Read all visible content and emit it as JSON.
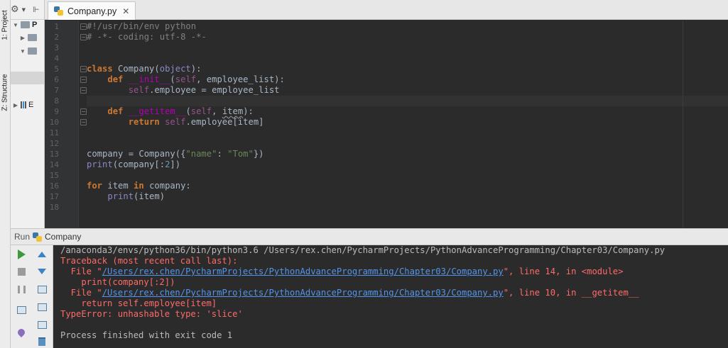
{
  "tool_windows": {
    "project_label": "1: Project",
    "structure_label": "Z: Structure"
  },
  "project_panel": {
    "rows": [
      {
        "label": "P",
        "arrow": "▼"
      },
      {
        "label": "",
        "arrow": "▶"
      },
      {
        "label": "",
        "arrow": "▼"
      },
      {
        "label": "",
        "arrow": ""
      },
      {
        "label": "E",
        "arrow": "▶"
      }
    ]
  },
  "editor_tab": {
    "filename": "Company.py",
    "close": "✕"
  },
  "editor": {
    "line_numbers": [
      "1",
      "2",
      "3",
      "4",
      "5",
      "6",
      "7",
      "8",
      "9",
      "10",
      "11",
      "12",
      "13",
      "14",
      "15",
      "16",
      "17",
      "18"
    ],
    "code": [
      [
        {
          "t": "#!/usr/bin/env python",
          "c": "cm"
        }
      ],
      [
        {
          "t": "# -*- coding: utf-8 -*-",
          "c": "cm"
        }
      ],
      [],
      [],
      [
        {
          "t": "class ",
          "c": "kw"
        },
        {
          "t": "Company",
          "c": "pl"
        },
        {
          "t": "(",
          "c": "pl"
        },
        {
          "t": "object",
          "c": "bi"
        },
        {
          "t": "):",
          "c": "pl"
        }
      ],
      [
        {
          "t": "    ",
          "c": "pl"
        },
        {
          "t": "def ",
          "c": "kw"
        },
        {
          "t": "__init__",
          "c": "mg"
        },
        {
          "t": "(",
          "c": "pl"
        },
        {
          "t": "self",
          "c": "sf"
        },
        {
          "t": ", employee_list):",
          "c": "pl"
        }
      ],
      [
        {
          "t": "        ",
          "c": "pl"
        },
        {
          "t": "self",
          "c": "sf"
        },
        {
          "t": ".employee = employee_list",
          "c": "pl"
        }
      ],
      [],
      [
        {
          "t": "    ",
          "c": "pl"
        },
        {
          "t": "def ",
          "c": "kw"
        },
        {
          "t": "__getitem__",
          "c": "mg"
        },
        {
          "t": "(",
          "c": "pl"
        },
        {
          "t": "self",
          "c": "sf"
        },
        {
          "t": ", ",
          "c": "pl"
        },
        {
          "t": "item",
          "c": "pl wavy"
        },
        {
          "t": "):",
          "c": "pl"
        }
      ],
      [
        {
          "t": "        ",
          "c": "pl"
        },
        {
          "t": "return ",
          "c": "kw"
        },
        {
          "t": "self",
          "c": "sf"
        },
        {
          "t": ".employee[item]",
          "c": "pl"
        }
      ],
      [],
      [],
      [
        {
          "t": "company = Company({",
          "c": "pl"
        },
        {
          "t": "\"name\"",
          "c": "st"
        },
        {
          "t": ": ",
          "c": "pl"
        },
        {
          "t": "\"Tom\"",
          "c": "st"
        },
        {
          "t": "})",
          "c": "pl"
        }
      ],
      [
        {
          "t": "print",
          "c": "bi"
        },
        {
          "t": "(company[:",
          "c": "pl"
        },
        {
          "t": "2",
          "c": "nm"
        },
        {
          "t": "])",
          "c": "pl"
        }
      ],
      [],
      [
        {
          "t": "for ",
          "c": "kw"
        },
        {
          "t": "item ",
          "c": "pl"
        },
        {
          "t": "in ",
          "c": "kw"
        },
        {
          "t": "company:",
          "c": "pl"
        }
      ],
      [
        {
          "t": "    ",
          "c": "pl"
        },
        {
          "t": "print",
          "c": "bi"
        },
        {
          "t": "(item)",
          "c": "pl"
        }
      ],
      []
    ],
    "current_line": 8
  },
  "run_panel": {
    "run_label": "Run",
    "config_name": "Company"
  },
  "console": {
    "command": "/anaconda3/envs/python36/bin/python3.6 /Users/rex.chen/PycharmProjects/PythonAdvanceProgramming/Chapter03/Company.py",
    "traceback_header": "Traceback (most recent call last):",
    "frame1_prefix": "  File \"",
    "frame1_link": "/Users/rex.chen/PycharmProjects/PythonAdvanceProgramming/Chapter03/Company.py",
    "frame1_suffix": "\", line 14, in <module>",
    "frame1_code": "    print(company[:2])",
    "frame2_prefix": "  File \"",
    "frame2_link": "/Users/rex.chen/PycharmProjects/PythonAdvanceProgramming/Chapter03/Company.py",
    "frame2_suffix": "\", line 10, in __getitem__",
    "frame2_code": "    return self.employee[item]",
    "error": "TypeError: unhashable type: 'slice'",
    "exit": "Process finished with exit code 1"
  },
  "colors": {
    "editor_bg": "#2b2b2b",
    "gutter_bg": "#313335",
    "error_text": "#ff6b68",
    "link": "#5394ec",
    "run_green": "#3c9a3c"
  }
}
